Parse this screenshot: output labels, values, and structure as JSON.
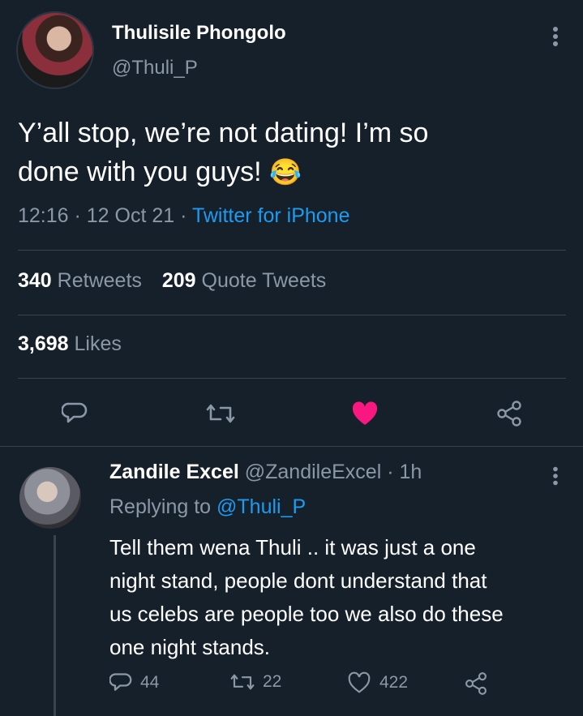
{
  "tweet": {
    "author_name": "Thulisile Phongolo",
    "author_handle": "@Thuli_P",
    "text_line1": "Y’all stop, we’re not dating! I’m so",
    "text_line2": "done with you guys!",
    "emoji": "😂",
    "time": "12:16 · 12 Oct 21 · ",
    "source": "Twitter for iPhone",
    "retweets_count": "340",
    "retweets_label": "Retweets",
    "quotes_count": "209",
    "quotes_label": "Quote Tweets",
    "likes_count": "3,698",
    "likes_label": "Likes",
    "liked": true,
    "accent_color": "#1d9bf0",
    "like_color": "#f91880"
  },
  "reply": {
    "author_name": "Zandile Excel",
    "author_handle": "@ZandileExcel · 1h",
    "replying_to_label": "Replying to",
    "replying_to_handle": "@Thuli_P",
    "text_lines": [
      "Tell them wena Thuli ..  it was just a one",
      "night stand, people dont understand that",
      "us celebs are people too we also do these",
      "one night stands."
    ],
    "reply_count": "44",
    "retweet_count": "22",
    "like_count": "422"
  }
}
